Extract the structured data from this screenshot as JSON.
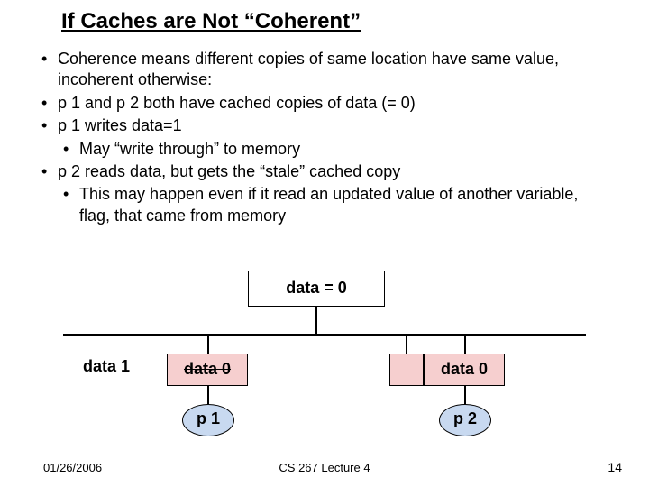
{
  "title": "If Caches are Not “Coherent”",
  "bullets": {
    "b1": "Coherence means different copies of same location have same value, incoherent otherwise:",
    "b2": "p 1 and p 2 both have cached copies of data (= 0)",
    "b3": "p 1 writes data=1",
    "b3a": "May  “write through” to memory",
    "b4": "p 2 reads data, but gets the “stale” cached copy",
    "b4a": "This may happen even if it read an updated value of another variable, flag, that came from memory"
  },
  "diagram": {
    "memory_label": "data = 0",
    "new_value_label": "data 1",
    "cache_left_label": "data  0",
    "cache_right_label": "data  0",
    "proc_left": "p 1",
    "proc_right": "p 2"
  },
  "footer": {
    "date": "01/26/2006",
    "center": "CS 267 Lecture 4",
    "slide_number": "14"
  }
}
